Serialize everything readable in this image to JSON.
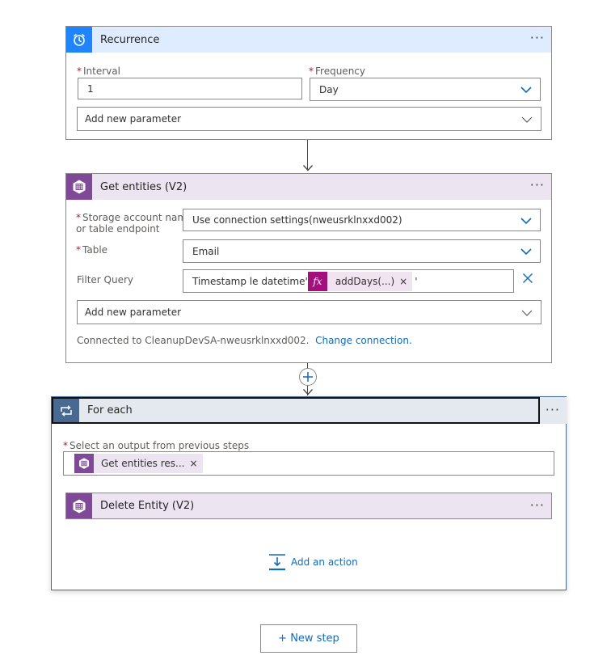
{
  "recurrence": {
    "title": "Recurrence",
    "more": "···",
    "interval_label": "Interval",
    "interval_value": "1",
    "frequency_label": "Frequency",
    "frequency_value": "Day",
    "add_param": "Add new parameter",
    "color": "#1f85ff"
  },
  "get_entities": {
    "title": "Get entities (V2)",
    "more": "···",
    "storage_label_1": "Storage account name",
    "storage_label_2": "or table endpoint",
    "storage_value": "Use connection settings(nweusrklnxxd002)",
    "table_label": "Table",
    "table_value": "Email",
    "filter_label": "Filter Query",
    "filter_text": "Timestamp le datetime'",
    "filter_token_fx": "fx",
    "filter_token": "addDays(...)",
    "filter_token_close": "×",
    "filter_suffix": "'",
    "add_param": "Add new parameter",
    "connected_text": "Connected to CleanupDevSA-nweusrklnxxd002.",
    "change_connection": "Change connection.",
    "color": "#804998"
  },
  "for_each": {
    "title": "For each",
    "more": "···",
    "select_label": "Select an output from previous steps",
    "select_token": "Get entities res...",
    "select_token_close": "×",
    "inner_action_title": "Delete Entity (V2)",
    "inner_more": "···",
    "add_action": "Add an action",
    "color": "#486991"
  },
  "new_step": "+ New step"
}
